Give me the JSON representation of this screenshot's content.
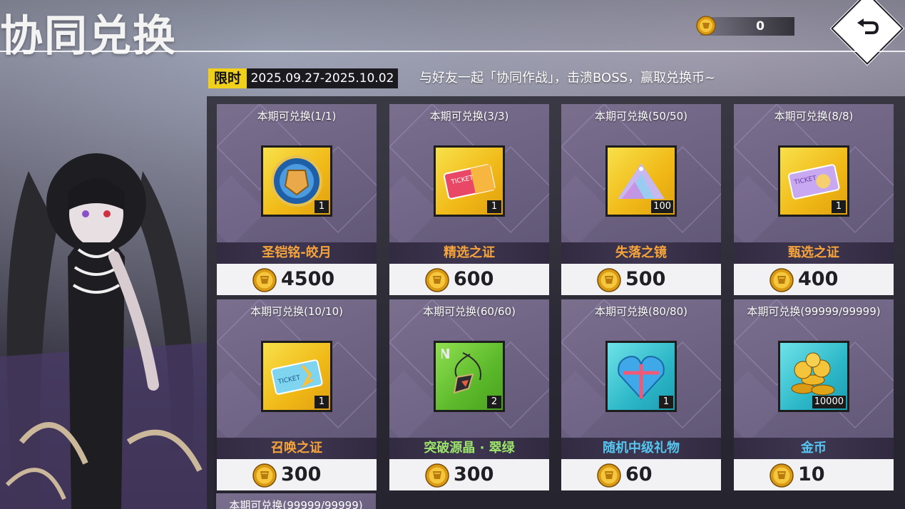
{
  "header": {
    "title": "协同兑换",
    "currency_value": "0"
  },
  "banner": {
    "tag": "限时",
    "date_range": "2025.09.27-2025.10.02",
    "description": "与好友一起「协同作战」，击溃BOSS，赢取兑换币~"
  },
  "items": [
    {
      "limit": "本期可兑换(1/1)",
      "name": "圣铠铭-皎月",
      "name_color": "#f5a33a",
      "qty": "1",
      "price": "4500",
      "bg": "gold",
      "icon": "crest-icon"
    },
    {
      "limit": "本期可兑换(3/3)",
      "name": "精选之证",
      "name_color": "#f5a33a",
      "qty": "1",
      "price": "600",
      "bg": "gold",
      "icon": "ticket-red-icon"
    },
    {
      "limit": "本期可兑换(50/50)",
      "name": "失落之镜",
      "name_color": "#f5a33a",
      "qty": "100",
      "price": "500",
      "bg": "gold",
      "icon": "crystal-pile-icon"
    },
    {
      "limit": "本期可兑换(8/8)",
      "name": "甄选之证",
      "name_color": "#f5a33a",
      "qty": "1",
      "price": "400",
      "bg": "gold",
      "icon": "ticket-purple-icon"
    },
    {
      "limit": "本期可兑换(10/10)",
      "name": "召唤之证",
      "name_color": "#f5a33a",
      "qty": "1",
      "price": "300",
      "bg": "gold",
      "icon": "ticket-blue-icon"
    },
    {
      "limit": "本期可兑换(60/60)",
      "name": "突破源晶 · 翠绿",
      "name_color": "#9be36a",
      "qty": "2",
      "price": "300",
      "bg": "green",
      "icon": "pendant-icon"
    },
    {
      "limit": "本期可兑换(80/80)",
      "name": "随机中级礼物",
      "name_color": "#56c6f0",
      "qty": "1",
      "price": "60",
      "bg": "cyan",
      "icon": "heart-gift-icon"
    },
    {
      "limit": "本期可兑换(99999/99999)",
      "name": "金币",
      "name_color": "#56c6f0",
      "qty": "10000",
      "price": "10",
      "bg": "cyan",
      "icon": "gold-coins-icon"
    }
  ],
  "peek_card": {
    "limit": "本期可兑换(99999/99999)"
  }
}
